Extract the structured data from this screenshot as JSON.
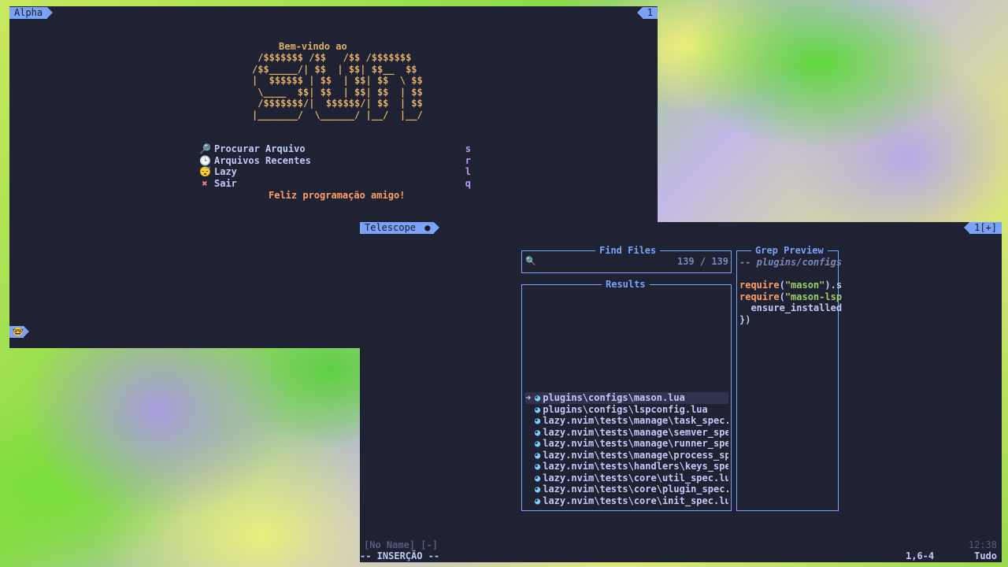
{
  "alpha": {
    "tab_title": "Alpha",
    "tab_number": "1",
    "header": "Bem-vindo ao",
    "ascii_art": [
      " /$$$$$$$ /$$   /$$ /$$$$$$$",
      "/$$_____/| $$  | $$| $$__  $$",
      "|  $$$$$$ | $$  | $$| $$  \\ $$",
      " \\____  $$| $$  | $$| $$  | $$",
      " /$$$$$$$/|  $$$$$$/| $$  | $$",
      "|_______/  \\______/ |__/  |__/"
    ],
    "menu": [
      {
        "icon": "🔎",
        "icon_name": "search-icon",
        "label": "Procurar Arquivo",
        "key": "s"
      },
      {
        "icon": "🕒",
        "icon_name": "clock-icon",
        "label": "Arquivos Recentes",
        "key": "r"
      },
      {
        "icon": "😴",
        "icon_name": "sleepy-face-icon",
        "label": "Lazy",
        "key": "l"
      },
      {
        "icon": "✖",
        "icon_name": "close-icon",
        "label": "Sair",
        "key": "q"
      }
    ],
    "footer": "Feliz programação amigo!",
    "status_icon": "🤓"
  },
  "editor": {
    "tab_title": "Telescope",
    "tab_dot": "●",
    "tab_number": "1[+]",
    "find_files": {
      "title": "Find Files",
      "prompt_icon": "🔍",
      "query": "",
      "count": "139 / 139"
    },
    "results": {
      "title": "Results",
      "selected_marker": "➜",
      "items": [
        "plugins\\configs\\mason.lua",
        "plugins\\configs\\lspconfig.lua",
        "lazy.nvim\\tests\\manage\\task_spec.l",
        "lazy.nvim\\tests\\manage\\semver_spec",
        "lazy.nvim\\tests\\manage\\runner_spec",
        "lazy.nvim\\tests\\manage\\process_spe",
        "lazy.nvim\\tests\\handlers\\keys_spec",
        "lazy.nvim\\tests\\core\\util_spec.lua",
        "lazy.nvim\\tests\\core\\plugin_spec.l",
        "lazy.nvim\\tests\\core\\init_spec.lua"
      ]
    },
    "preview": {
      "title": "Grep Preview",
      "path_line": "-- plugins/configs",
      "code": [
        {
          "kw": "require",
          "p1": "(",
          "str": "\"mason\"",
          "rest": ").s"
        },
        {
          "kw": "require",
          "p1": "(",
          "str": "\"mason-lsp",
          "rest": ""
        },
        {
          "kw": "",
          "p1": "",
          "str": "",
          "rest": "  ensure_installed"
        },
        {
          "kw": "",
          "p1": "",
          "str": "",
          "rest": "})"
        }
      ]
    },
    "statusline": {
      "buffer_name": "[No Name] [-]",
      "time": "12:38",
      "mode": "-- INSERÇÃO --",
      "position": "1,6-4",
      "scroll": "Tudo"
    }
  }
}
